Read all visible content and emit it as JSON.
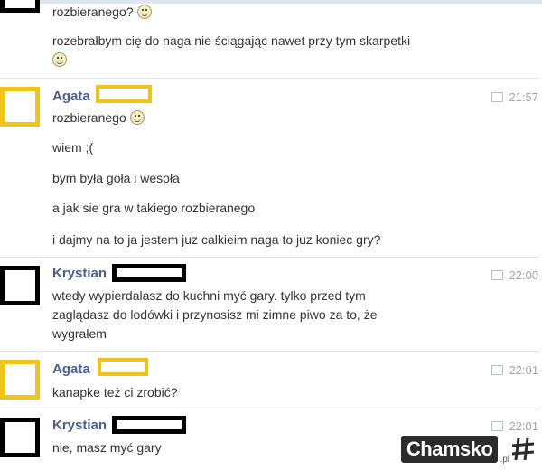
{
  "messages_top": {
    "line1": "rozbieranego?",
    "line2": "rozebrałbym cię do naga nie ściągając nawet przy tym skarpetki"
  },
  "group_agata_1": {
    "name": "Agata",
    "time": "21:57",
    "lines": [
      "rozbieranego",
      "wiem ;(",
      "bym była goła i wesoła",
      "a jak sie gra w takiego rozbieranego",
      "i dajmy na to ja jestem juz calkieim naga to juz koniec gry?"
    ]
  },
  "group_krystian_1": {
    "name": "Krystian",
    "time": "22:00",
    "lines": [
      "wtedy wypierdalasz do kuchni myć gary. tylko przed tym",
      "zaglądasz do lodówki i przynosisz mi zimne piwo za to, że",
      "wygrałem"
    ]
  },
  "group_agata_2": {
    "name": "Agata",
    "time": "22:01",
    "lines": [
      "kanapke też ci zrobić?"
    ]
  },
  "group_krystian_2": {
    "name": "Krystian",
    "time": "22:01",
    "lines": [
      "nie, masz myć gary"
    ]
  },
  "watermark": {
    "text": "Chamsko",
    "suffix": ".pl"
  },
  "colors": {
    "name": "#4a5f8f",
    "yellow_redaction": "#f0c419",
    "black_redaction": "#000000",
    "time": "#a0a6b2"
  }
}
